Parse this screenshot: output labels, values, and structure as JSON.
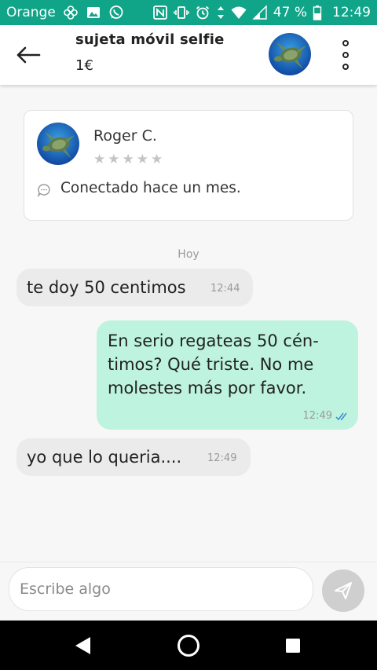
{
  "status_bar": {
    "carrier": "Orange",
    "battery": "47 %",
    "time": "12:49",
    "icons": [
      "flower-icon",
      "image-icon",
      "whatsapp-icon",
      "nfc-icon",
      "vibrate-icon",
      "alarm-icon",
      "data-arrows-icon",
      "wifi-icon",
      "signal-icon",
      "battery-icon"
    ],
    "bg_color": "#10a488"
  },
  "header": {
    "back_icon": "arrow-left-icon",
    "title": "sujeta móvil selfie",
    "price": "1€",
    "menu_icon": "more-vertical-icon"
  },
  "user_card": {
    "name": "Roger C.",
    "rating": 0,
    "rating_max": 5,
    "status": "Conectado hace un mes."
  },
  "day_label": "Hoy",
  "messages": [
    {
      "direction": "in",
      "text": "te doy 50 centimos",
      "time": "12:44"
    },
    {
      "direction": "out",
      "lines": [
        "En serio regateas 50 cén-",
        "timos? Qué triste. No me",
        "molestes más por favor."
      ],
      "time": "12:49",
      "status": "read"
    },
    {
      "direction": "in",
      "text": "yo que lo queria....",
      "time": "12:49"
    }
  ],
  "composer": {
    "placeholder": "Escribe algo",
    "send_icon": "send-icon"
  },
  "nav_bar": {
    "icons": [
      "back-triangle-icon",
      "home-circle-icon",
      "recents-square-icon"
    ]
  },
  "colors": {
    "accent": "#10a488",
    "outgoing_bubble": "#bdf3df",
    "incoming_bubble": "#ebebeb",
    "read_ticks": "#3d8bd1"
  }
}
